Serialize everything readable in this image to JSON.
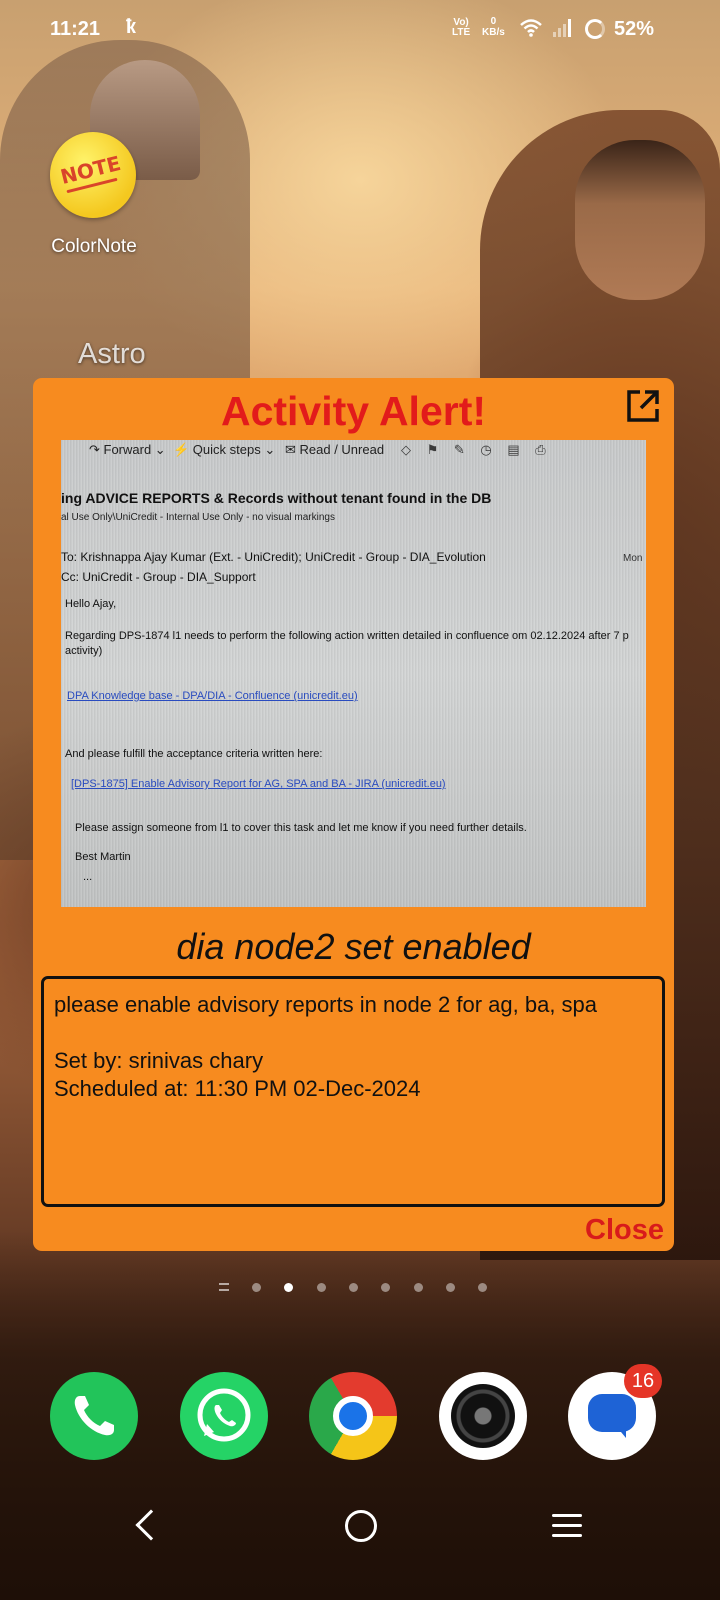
{
  "status_bar": {
    "time": "11:21",
    "network_label_top": "Vo)",
    "network_label_bottom": "LTE",
    "speed_value": "0",
    "speed_unit": "KB/s",
    "battery": "52%"
  },
  "home": {
    "apps": [
      {
        "label": "ColorNote",
        "icon": "colornote-icon",
        "icon_text": "NOTE"
      },
      {
        "label": "Astro"
      }
    ],
    "page_indicator": {
      "pages": 8,
      "active": 1
    },
    "dock": [
      {
        "icon": "phone-icon"
      },
      {
        "icon": "whatsapp-icon"
      },
      {
        "icon": "chrome-icon"
      },
      {
        "icon": "camera-icon"
      },
      {
        "icon": "messages-icon",
        "badge": "16"
      }
    ]
  },
  "alert": {
    "title": "Activity Alert!",
    "heading": "dia node2 set enabled",
    "message_lines": [
      "please enable advisory reports in node 2 for ag, ba, spa",
      "",
      "Set by: srinivas chary",
      "Scheduled at: 11:30 PM 02-Dec-2024"
    ],
    "close_label": "Close",
    "image": {
      "toolbar": {
        "forward": "↷ Forward ⌄",
        "quick_steps": "⚡ Quick steps ⌄",
        "read_unread": "✉ Read / Unread"
      },
      "subject": "ing ADVICE REPORTS & Records without tenant found in the DB",
      "label_line": "al Use Only\\UniCredit - Internal Use Only - no visual markings",
      "to_line": "To:  Krishnappa Ajay Kumar (Ext. - UniCredit);  UniCredit - Group - DIA_Evolution",
      "date_fragment": "Mon",
      "cc_line": "Cc:  UniCredit - Group - DIA_Support",
      "greeting": "Hello Ajay,",
      "body_1": "Regarding DPS-1874 l1 needs to perform the following action written detailed in confluence om 02.12.2024 after 7 p",
      "body_1b": "activity)",
      "link_1": "DPA Knowledge base - DPA/DIA - Confluence (unicredit.eu)",
      "body_2": "And please fulfill the acceptance criteria written here:",
      "link_2": "[DPS-1875] Enable Advisory Report for AG, SPA and BA - JIRA (unicredit.eu)",
      "body_3": "Please assign someone from l1 to cover this task and let me know if you need further details.",
      "signoff": "Best Martin",
      "ellipsis": "..."
    }
  },
  "colors": {
    "alert_background": "#f78b1f",
    "alert_title": "#e21b1b",
    "close": "#d81b1b",
    "badge": "#e53527"
  }
}
